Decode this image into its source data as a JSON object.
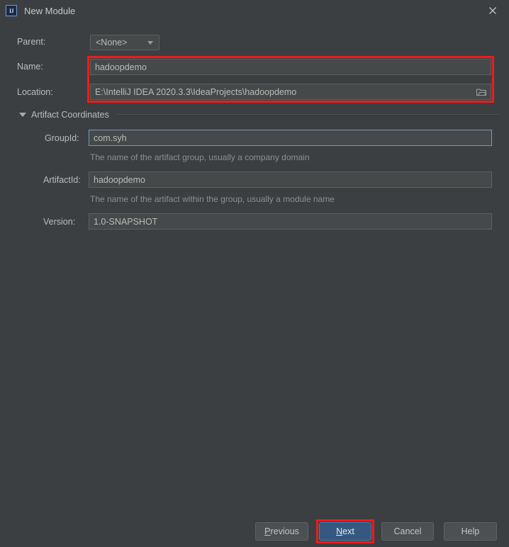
{
  "window": {
    "title": "New Module",
    "app_icon": "intellij-idea-icon",
    "close_icon": "close-icon",
    "background_color": "#3c3f41"
  },
  "form": {
    "parent": {
      "label": "Parent:",
      "value": "<None>",
      "dropdown_icon": "chevron-down-icon"
    },
    "name": {
      "label": "Name:",
      "value": "hadoopdemo"
    },
    "location": {
      "label": "Location:",
      "value": "E:\\IntelliJ IDEA 2020.3.3\\IdeaProjects\\hadoopdemo",
      "browse_icon": "folder-icon"
    }
  },
  "artifact_coordinates": {
    "section_label": "Artifact Coordinates",
    "expanded": true,
    "collapse_icon": "triangle-down-icon",
    "group_id": {
      "label": "GroupId:",
      "value": "com.syh",
      "hint": "The name of the artifact group, usually a company domain",
      "focused": true
    },
    "artifact_id": {
      "label": "ArtifactId:",
      "value": "hadoopdemo",
      "hint": "The name of the artifact within the group, usually a module name"
    },
    "version": {
      "label": "Version:",
      "value": "1.0-SNAPSHOT"
    }
  },
  "buttons": {
    "previous": {
      "prefix": "",
      "mnemonic": "P",
      "suffix": "revious"
    },
    "next": {
      "prefix": "",
      "mnemonic": "N",
      "suffix": "ext",
      "primary": true
    },
    "cancel": {
      "label": "Cancel"
    },
    "help": {
      "label": "Help"
    }
  },
  "annotations": {
    "highlight_color": "#ef1b1b",
    "boxes": [
      "name-location-fields",
      "next-button"
    ]
  }
}
